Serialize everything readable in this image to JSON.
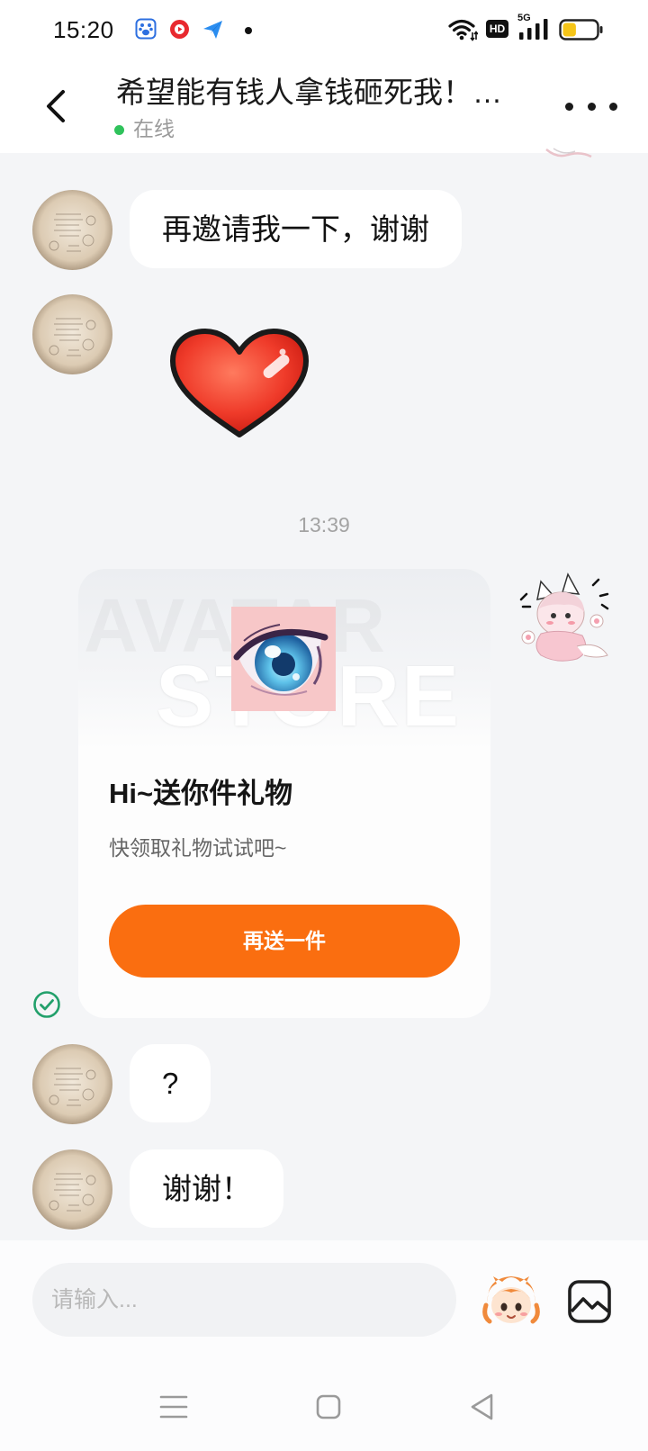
{
  "status_bar": {
    "time": "15:20",
    "notification_icons": [
      "baidu-app-icon",
      "red-video-app-icon",
      "paper-plane-app-icon",
      "dot-icon"
    ],
    "hd_label": "HD",
    "network_label": "5G",
    "battery_level": 0.4,
    "battery_color": "#f5c518"
  },
  "header": {
    "title": "希望能有钱人拿钱砸死我！…",
    "status": "在线",
    "status_color": "#2fc25b",
    "back_icon": "chevron-left-icon",
    "more_icon": "more-dots-icon"
  },
  "messages": [
    {
      "type": "text",
      "side": "left",
      "text": "再邀请我一下，谢谢"
    },
    {
      "type": "sticker",
      "side": "left",
      "sticker": "red-heart-sticker"
    },
    {
      "type": "timestamp",
      "text": "13:39"
    },
    {
      "type": "gift_card",
      "side": "right",
      "banner_watermark": [
        "AVATAR",
        "STORE"
      ],
      "gift_image": "anime-eye-image",
      "title": "Hi~送你件礼物",
      "subtitle": "快领取礼物试试吧~",
      "button_label": "再送一件",
      "sender_avatar": "anime-girl-sticker",
      "delivery_icon": "sent-check-icon"
    },
    {
      "type": "text",
      "side": "left",
      "text": "?"
    },
    {
      "type": "text",
      "side": "left",
      "text": "谢谢！"
    }
  ],
  "composer": {
    "placeholder": "请输入...",
    "emoji_icon": "anime-emoji-icon",
    "image_icon": "image-icon"
  },
  "nav_bar": {
    "icons": [
      "menu-icon",
      "home-square-icon",
      "back-triangle-icon"
    ]
  },
  "colors": {
    "accent": "#fa6e10",
    "chat_bg": "#f4f5f7",
    "bubble": "#ffffff",
    "check": "#22a06b"
  }
}
